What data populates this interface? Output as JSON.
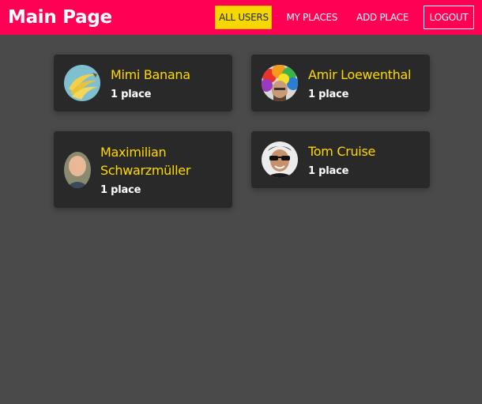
{
  "header": {
    "title": "Main Page",
    "nav": {
      "all_users": "ALL USERS",
      "my_places": "MY PLACES",
      "add_place": "ADD PLACE",
      "logout": "LOGOUT"
    }
  },
  "users": [
    {
      "name": "Mimi Banana",
      "places": "1 place",
      "avatar": "banana-avatar"
    },
    {
      "name": "Amir Loewenthal",
      "places": "1 place",
      "avatar": "rainbow-wig-avatar"
    },
    {
      "name": "Maximilian Schwarzmüller",
      "places": "1 place",
      "avatar": "man-portrait-avatar"
    },
    {
      "name": "Tom Cruise",
      "places": "1 place",
      "avatar": "sunglasses-avatar"
    }
  ],
  "colors": {
    "header_bg": "#ff0055",
    "active_nav": "#f5d800",
    "card_bg": "#292929",
    "name_color": "#ffd900",
    "page_bg": "#4a4a4a"
  }
}
